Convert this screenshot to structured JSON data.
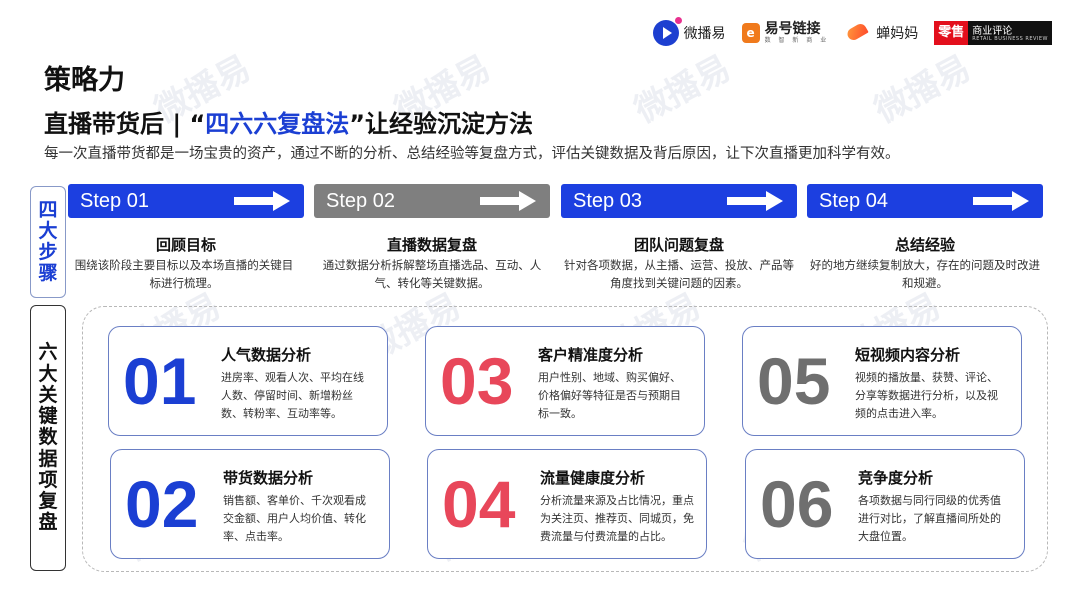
{
  "logos": {
    "weiboyi": "微播易",
    "yihaolianjie": "易号链接",
    "yihaolianjie_sub": "数 智 新 商 业",
    "chanmama": "蝉妈妈",
    "lingshou_red": "零售",
    "lingshou_black": "商业评论",
    "lingshou_en": "RETAIL BUSINESS REVIEW"
  },
  "watermark": "微播易",
  "title": "策略力",
  "subtitle": {
    "prefix": "直播带货后 | “",
    "highlight": "四六六复盘法",
    "suffix": "”让经验沉淀方法"
  },
  "description": "每一次直播带货都是一场宝贵的资产，通过不断的分析、总结经验等复盘方式，评估关键数据及背后原因，让下次直播更加科学有效。",
  "labels": {
    "four_steps": [
      "四",
      "大",
      "步",
      "骤"
    ],
    "six_items": [
      "六",
      "大",
      "关",
      "键",
      "数",
      "据",
      "项",
      "复",
      "盘"
    ]
  },
  "steps": [
    {
      "label": "Step 01",
      "title": "回顾目标",
      "desc": "围绕该阶段主要目标以及本场直播的关键目标进行梳理。"
    },
    {
      "label": "Step 02",
      "title": "直播数据复盘",
      "desc": "通过数据分析拆解整场直播选品、互动、人气、转化等关键数据。"
    },
    {
      "label": "Step 03",
      "title": "团队问题复盘",
      "desc": "针对各项数据，从主播、运营、投放、产品等角度找到关键问题的因素。"
    },
    {
      "label": "Step 04",
      "title": "总结经验",
      "desc": "好的地方继续复制放大，存在的问题及时改进和规避。"
    }
  ],
  "cards": [
    {
      "num": "01",
      "title": "人气数据分析",
      "desc": "进房率、观看人次、平均在线人数、停留时间、新增粉丝数、转粉率、互动率等。"
    },
    {
      "num": "02",
      "title": "带货数据分析",
      "desc": "销售额、客单价、千次观看成交金额、用户人均价值、转化率、点击率。"
    },
    {
      "num": "03",
      "title": "客户精准度分析",
      "desc": "用户性别、地域、购买偏好、价格偏好等特征是否与预期目标一致。"
    },
    {
      "num": "04",
      "title": "流量健康度分析",
      "desc": "分析流量来源及占比情况，重点为关注页、推荐页、同城页，免费流量与付费流量的占比。"
    },
    {
      "num": "05",
      "title": "短视频内容分析",
      "desc": "视频的播放量、获赞、评论、分享等数据进行分析，以及视频的点击进入率。"
    },
    {
      "num": "06",
      "title": "竞争度分析",
      "desc": "各项数据与同行同级的优秀值进行对比，了解直播间所处的大盘位置。"
    }
  ],
  "colors": {
    "blue": "#1b3fd3",
    "step_blue": "#1c3fe0",
    "step_gray": "#7f7f7f",
    "red": "#e8475a",
    "gray": "#6f6f6f"
  }
}
